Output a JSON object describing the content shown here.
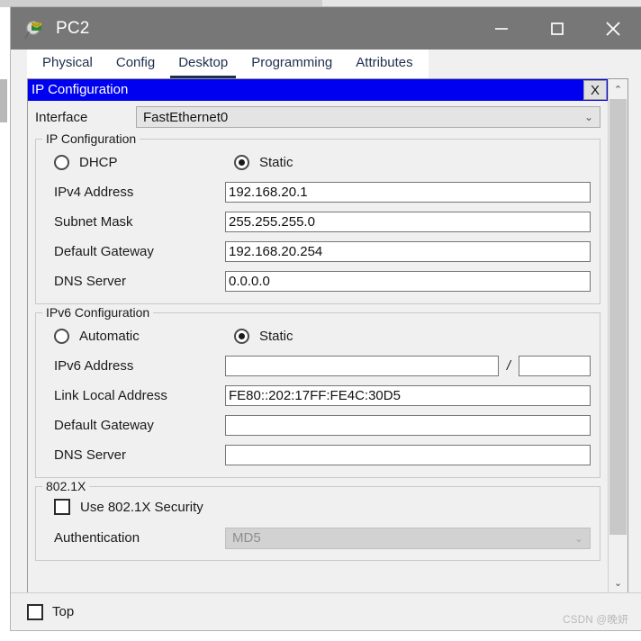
{
  "window": {
    "title": "PC2",
    "icon": "packet-tracer-pc-icon",
    "controls": {
      "minimize": "minimize-icon",
      "maximize": "maximize-icon",
      "close": "close-icon"
    }
  },
  "tabs": [
    {
      "label": "Physical",
      "active": false
    },
    {
      "label": "Config",
      "active": false
    },
    {
      "label": "Desktop",
      "active": true
    },
    {
      "label": "Programming",
      "active": false
    },
    {
      "label": "Attributes",
      "active": false
    }
  ],
  "dialog": {
    "title": "IP Configuration",
    "close_label": "X",
    "interface": {
      "label": "Interface",
      "value": "FastEthernet0",
      "chevron": "⌄"
    },
    "ipv4": {
      "legend": "IP Configuration",
      "mode_dhcp": "DHCP",
      "mode_static": "Static",
      "selected_mode": "Static",
      "fields": [
        {
          "label": "IPv4 Address",
          "value": "192.168.20.1"
        },
        {
          "label": "Subnet Mask",
          "value": "255.255.255.0"
        },
        {
          "label": "Default Gateway",
          "value": "192.168.20.254"
        },
        {
          "label": "DNS Server",
          "value": "0.0.0.0"
        }
      ]
    },
    "ipv6": {
      "legend": "IPv6 Configuration",
      "mode_automatic": "Automatic",
      "mode_static": "Static",
      "selected_mode": "Static",
      "address_label": "IPv6 Address",
      "address_value": "",
      "prefix_separator": "/",
      "prefix_value": "",
      "fields": [
        {
          "label": "Link Local Address",
          "value": "FE80::202:17FF:FE4C:30D5"
        },
        {
          "label": "Default Gateway",
          "value": ""
        },
        {
          "label": "DNS Server",
          "value": ""
        }
      ]
    },
    "dot1x": {
      "legend": "802.1X",
      "use_security_label": "Use 802.1X Security",
      "use_security_checked": false,
      "auth_label": "Authentication",
      "auth_value": "MD5",
      "auth_disabled": true,
      "chevron": "⌄"
    }
  },
  "scrollbar": {
    "up": "⌃",
    "down": "⌄"
  },
  "bottom": {
    "top_label": "Top",
    "top_checked": false
  },
  "watermark": "CSDN @晚妍",
  "colors": {
    "title_bar": "#777777",
    "dialog_title_bar": "#0000f0",
    "tab_active": "#1d2f4d",
    "panel": "#f0f0f0",
    "field_border": "#767676"
  }
}
